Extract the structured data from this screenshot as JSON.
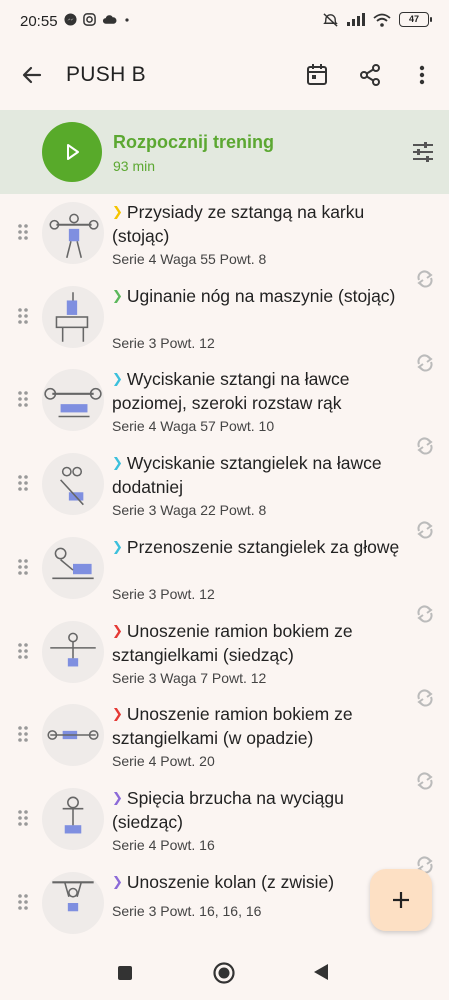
{
  "status_bar": {
    "time": "20:55",
    "left_icons": [
      "messenger-icon",
      "instagram-icon",
      "cloud-icon",
      "dot-icon"
    ],
    "right_icons": [
      "alarm-off-icon",
      "signal-icon",
      "wifi-icon",
      "battery-icon"
    ],
    "battery": "47"
  },
  "app_bar": {
    "title": "PUSH B",
    "icons": [
      "back-arrow-icon",
      "calendar-icon",
      "share-icon",
      "more-vert-icon"
    ]
  },
  "start": {
    "title": "Rozpocznij trening",
    "duration": "93 min",
    "colors": {
      "accent": "#58aa2a",
      "banner": "#e3e9df"
    }
  },
  "exercises": [
    {
      "chev_color": "#f5c400",
      "name": "Przysiady ze sztangą na karku (stojąc)",
      "details": "Serie 4 Waga 55 Powt. 8"
    },
    {
      "chev_color": "#5cb85c",
      "name": "Uginanie nóg na maszynie (stojąc)",
      "details": "Serie 3 Powt. 12"
    },
    {
      "chev_color": "#3cc0dc",
      "name": "Wyciskanie sztangi na ławce poziomej, szeroki rozstaw rąk",
      "details": "Serie 4 Waga 57 Powt. 10"
    },
    {
      "chev_color": "#3cc0dc",
      "name": "Wyciskanie sztangielek na ławce dodatniej",
      "details": "Serie 3 Waga 22 Powt. 8"
    },
    {
      "chev_color": "#3cc0dc",
      "name": "Przenoszenie sztangielek za głowę",
      "details": "Serie 3 Powt. 12"
    },
    {
      "chev_color": "#e53935",
      "name": "Unoszenie ramion bokiem ze sztangielkami (siedząc)",
      "details": "Serie 3 Waga 7 Powt. 12"
    },
    {
      "chev_color": "#e53935",
      "name": "Unoszenie ramion bokiem ze sztangielkami (w opadzie)",
      "details": "Serie 4 Powt. 20"
    },
    {
      "chev_color": "#8c6ad8",
      "name": "Spięcia brzucha na wyciągu (siedząc)",
      "details": "Serie 4 Powt. 16"
    },
    {
      "chev_color": "#8c6ad8",
      "name": "Unoszenie kolan (z zwisie)",
      "details": "Serie 3 Powt. 16, 16, 16"
    }
  ],
  "fab": {
    "icon": "plus-icon",
    "color": "#fde0c4"
  },
  "nav_bar": {
    "icons": [
      "recents-square-icon",
      "home-circle-icon",
      "back-triangle-icon"
    ]
  }
}
